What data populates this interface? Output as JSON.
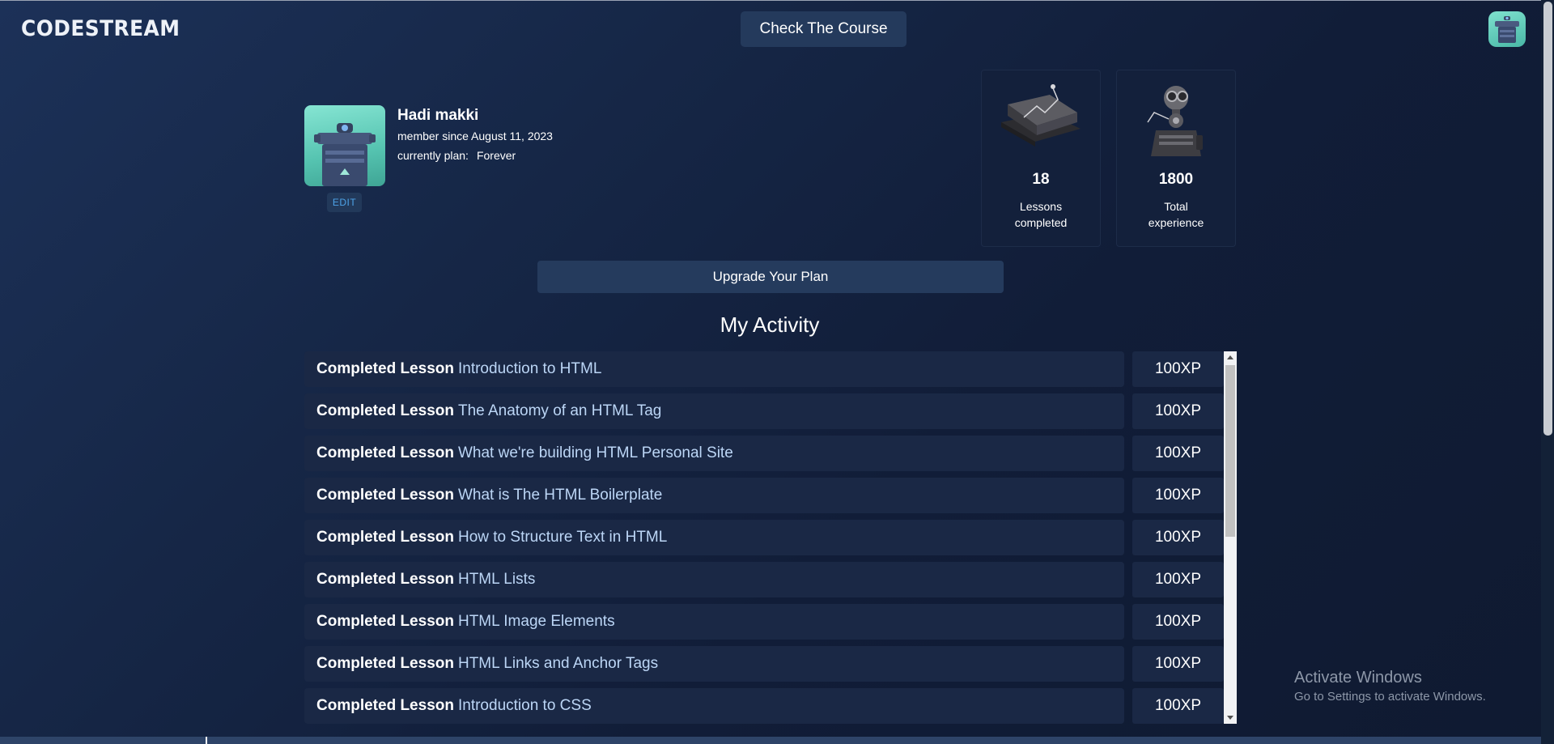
{
  "header": {
    "logo": "CODESTREAM",
    "check_course": "Check The Course"
  },
  "profile": {
    "name": "Hadi makki",
    "member_since": "member since August 11, 2023",
    "plan_label": "currently plan:",
    "plan_value": "Forever",
    "edit": "EDIT"
  },
  "stats": [
    {
      "value": "18",
      "label": "Lessons completed",
      "icon": "layers-illustration"
    },
    {
      "value": "1800",
      "label": "Total experience",
      "icon": "robot-illustration"
    }
  ],
  "upgrade": "Upgrade Your Plan",
  "activity": {
    "title": "My Activity",
    "prefix": "Completed Lesson",
    "items": [
      {
        "lesson": "Introduction to HTML",
        "xp": "100XP"
      },
      {
        "lesson": "The Anatomy of an HTML Tag",
        "xp": "100XP"
      },
      {
        "lesson": "What we're building HTML Personal Site",
        "xp": "100XP"
      },
      {
        "lesson": "What is The HTML Boilerplate",
        "xp": "100XP"
      },
      {
        "lesson": "How to Structure Text in HTML",
        "xp": "100XP"
      },
      {
        "lesson": "HTML Lists",
        "xp": "100XP"
      },
      {
        "lesson": "HTML Image Elements",
        "xp": "100XP"
      },
      {
        "lesson": "HTML Links and Anchor Tags",
        "xp": "100XP"
      },
      {
        "lesson": "Introduction to CSS",
        "xp": "100XP"
      }
    ]
  },
  "watermark": {
    "title": "Activate Windows",
    "subtitle": "Go to Settings to activate Windows."
  }
}
